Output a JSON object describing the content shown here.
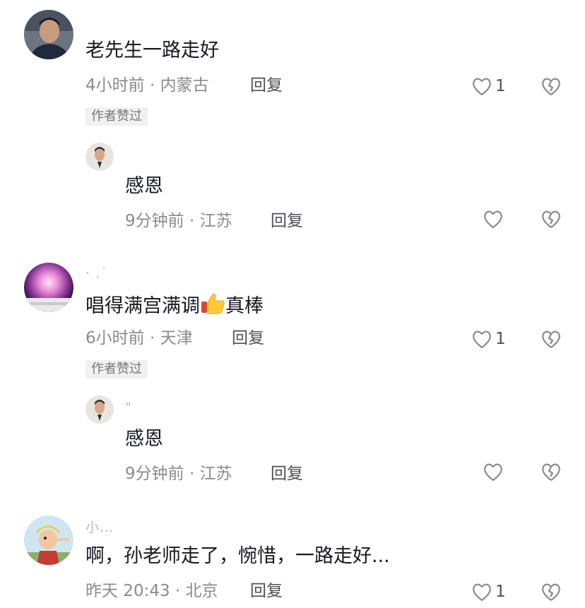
{
  "comments": [
    {
      "text": "老先生一路走好",
      "meta": "4小时前 · 内蒙古",
      "reply": "回复",
      "likes": "1",
      "badge": "作者赞过",
      "replies": [
        {
          "text": "感恩",
          "meta": "9分钟前 · 江苏",
          "reply": "回复"
        }
      ]
    },
    {
      "username": "· .˙",
      "text_before": "唱得满宫满调",
      "text_after": "真棒",
      "emoji": "thumbs-up-icon",
      "meta": "6小时前 · 天津",
      "reply": "回复",
      "likes": "1",
      "badge": "作者赞过",
      "replies": [
        {
          "username": "\"",
          "text": "感恩",
          "meta": "9分钟前 · 江苏",
          "reply": "回复"
        }
      ]
    },
    {
      "username": "小…",
      "text": "啊，孙老师走了，惋惜，一路走好...",
      "meta": "昨天 20:43 · 北京",
      "reply": "回复",
      "likes": "1"
    }
  ],
  "colors": {
    "text": "#161823",
    "meta": "#8a8b91",
    "badge_bg": "#f1f1f2",
    "icon": "#8a8b91"
  }
}
